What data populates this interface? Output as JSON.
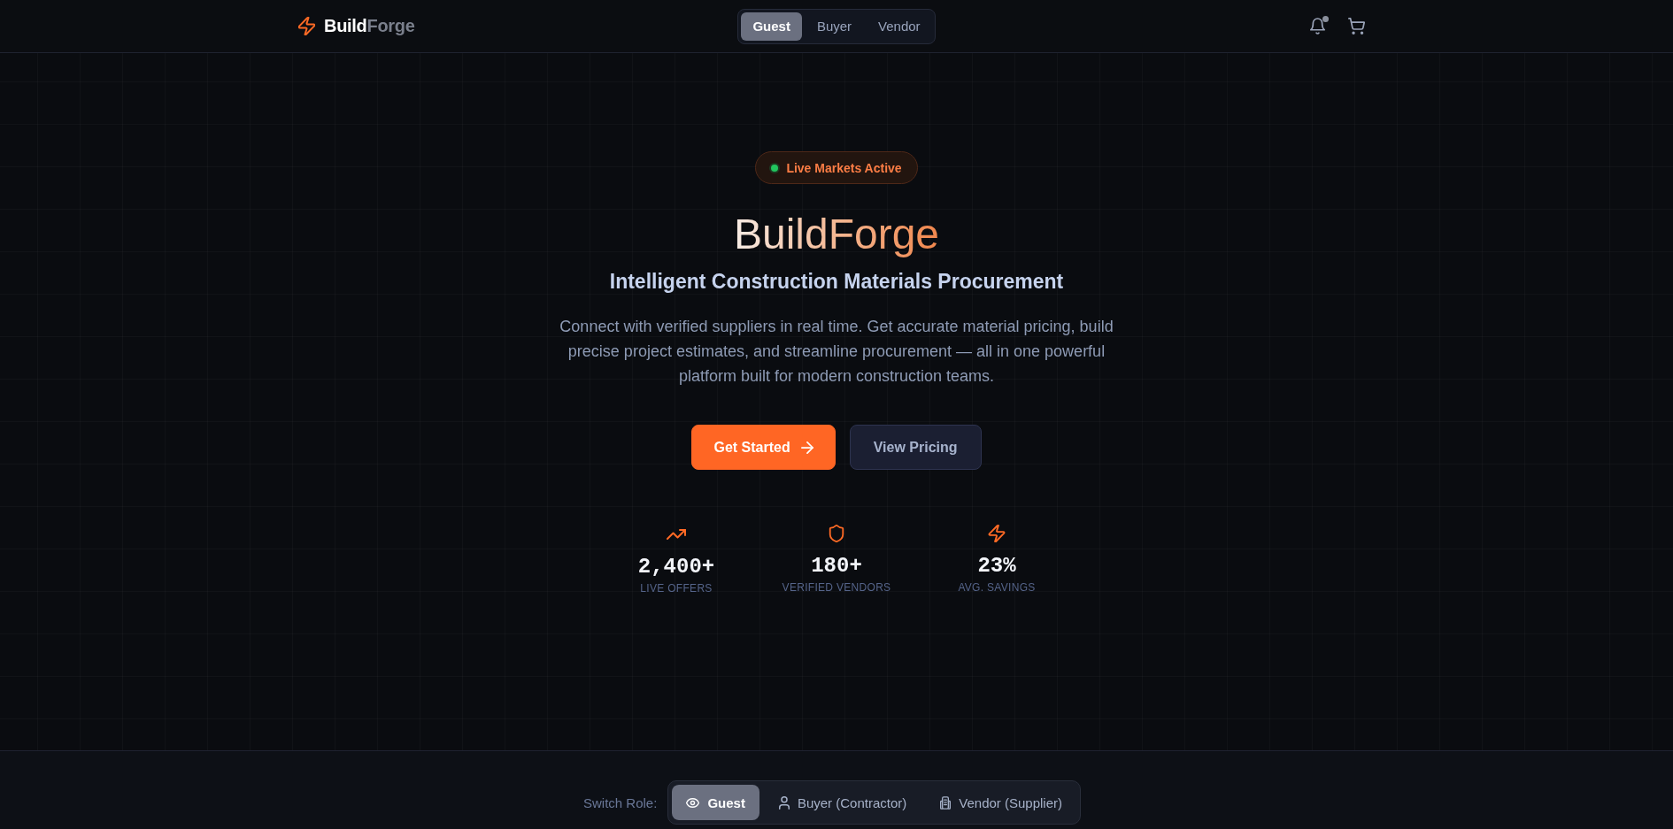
{
  "header": {
    "logo": {
      "text_1": "Build",
      "text_2": "Forge"
    },
    "role_tabs": [
      {
        "label": "Guest",
        "selected": true
      },
      {
        "label": "Buyer",
        "selected": false
      },
      {
        "label": "Vendor",
        "selected": false
      }
    ],
    "notifications": {
      "unread": true
    }
  },
  "hero": {
    "badge": {
      "label": "Live Markets Active"
    },
    "title": "BuildForge",
    "subtitle": "Intelligent Construction Materials Procurement",
    "description": "Connect with verified suppliers in real time. Get accurate material pricing, build precise project estimates, and streamline procurement — all in one powerful platform built for modern construction teams.",
    "buttons": [
      {
        "label": "Get Started",
        "kind": "primary"
      },
      {
        "label": "View Pricing",
        "kind": "secondary"
      }
    ],
    "stats": [
      {
        "value": "2,400+",
        "label": "LIVE OFFERS"
      },
      {
        "value": "180+",
        "label": "VERIFIED VENDORS"
      },
      {
        "value": "23%",
        "label": "AVG. SAVINGS"
      }
    ]
  },
  "role_switcher": {
    "label": "Switch Role:",
    "options": [
      {
        "label": "Guest",
        "selected": true
      },
      {
        "label": "Buyer (Contractor)",
        "selected": false
      },
      {
        "label": "Vendor (Supplier)",
        "selected": false
      }
    ]
  }
}
